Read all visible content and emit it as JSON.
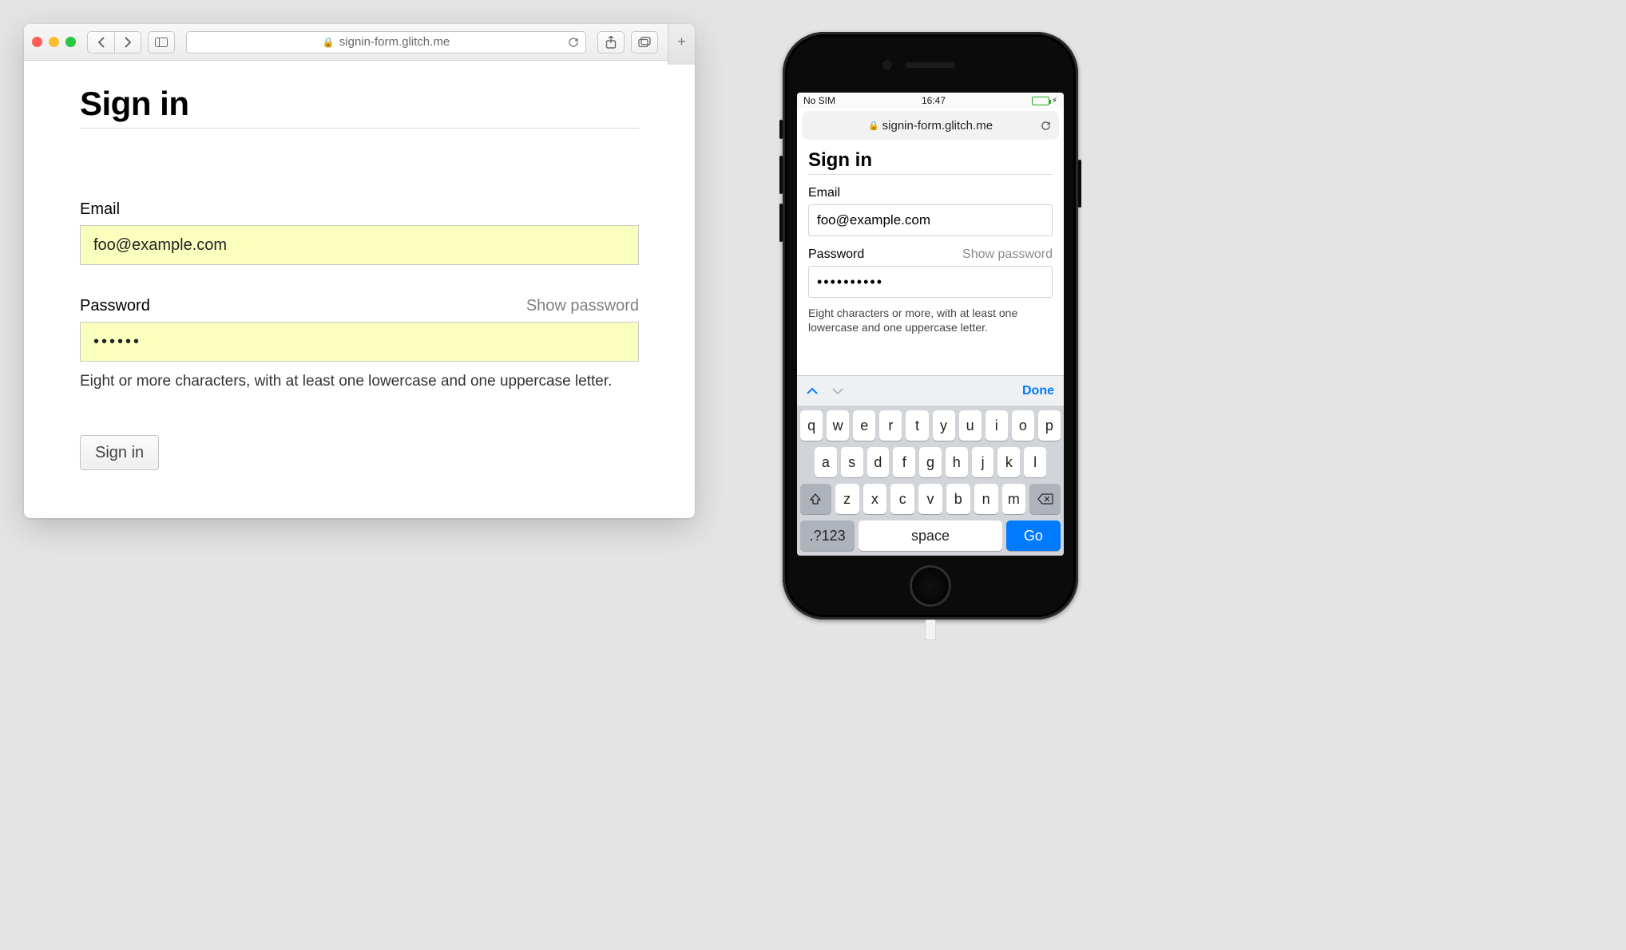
{
  "desktop": {
    "url_host": "signin-form.glitch.me",
    "page_title": "Sign in",
    "email_label": "Email",
    "email_value": "foo@example.com",
    "password_label": "Password",
    "show_password": "Show password",
    "password_value": "••••••",
    "password_hint": "Eight or more characters, with at least one lowercase and one uppercase letter.",
    "submit_label": "Sign in"
  },
  "mobile": {
    "status_carrier": "No SIM",
    "status_time": "16:47",
    "url_host": "signin-form.glitch.me",
    "page_title": "Sign in",
    "email_label": "Email",
    "email_value": "foo@example.com",
    "password_label": "Password",
    "show_password": "Show password",
    "password_value": "••••••••••",
    "password_hint": "Eight characters or more, with at least one lowercase and one uppercase letter.",
    "kb_done": "Done",
    "kb_rows": {
      "r1": [
        "q",
        "w",
        "e",
        "r",
        "t",
        "y",
        "u",
        "i",
        "o",
        "p"
      ],
      "r2": [
        "a",
        "s",
        "d",
        "f",
        "g",
        "h",
        "j",
        "k",
        "l"
      ],
      "r3": [
        "z",
        "x",
        "c",
        "v",
        "b",
        "n",
        "m"
      ]
    },
    "kb_switch": ".?123",
    "kb_space": "space",
    "kb_go": "Go"
  }
}
